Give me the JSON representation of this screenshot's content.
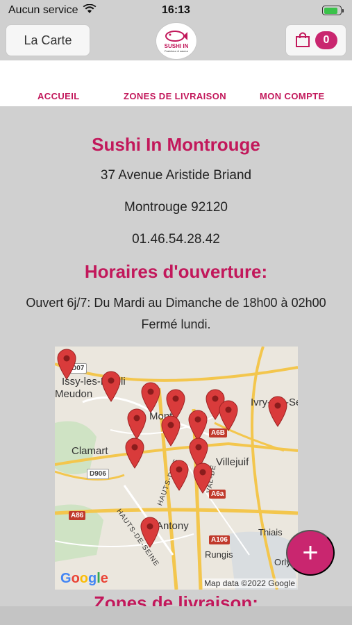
{
  "status_bar": {
    "carrier": "Aucun service",
    "time": "16:13",
    "battery_level": 0.85
  },
  "header": {
    "menu_label": "La Carte",
    "logo_title": "SUSHI IN",
    "logo_subtitle": "Fraîcheur & saveur",
    "cart_count": "0"
  },
  "nav": {
    "items": [
      "ACCUEIL",
      "ZONES DE LIVRAISON",
      "MON COMPTE"
    ]
  },
  "restaurant": {
    "name": "Sushi In Montrouge",
    "address": "37 Avenue Aristide Briand",
    "city": "Montrouge 92120",
    "phone": "01.46.54.28.42"
  },
  "hours": {
    "title": "Horaires d'ouverture:",
    "line1": "Ouvert 6j/7: Du Mardi au Dimanche de 18h00 à 02h00",
    "line2": "Fermé lundi."
  },
  "map": {
    "labels": {
      "issy": "Issy-les-Mouli",
      "meudon": "Meudon",
      "montrouge": "Mont",
      "ivry": "Ivry-sur-Sei",
      "clamart": "Clamart",
      "villejuif": "Villejuif",
      "antony": "Antony",
      "thiais": "Thiais",
      "rungis": "Rungis",
      "orly": "Orly",
      "hauts_de_seine_1": "HAUTS-DE-S",
      "hauts_de_seine_2": "HAUTS-DE-SEINE",
      "val_de": "VAL-DE"
    },
    "road_signs": {
      "d07": "D07",
      "a6b": "A6B",
      "d906": "D906",
      "a6a": "A6a",
      "a86": "A86",
      "a106": "A106"
    },
    "google": "Google",
    "attribution": "Map data ©2022 Google"
  },
  "zones_title": "Zones de livraison:",
  "fab_symbol": "+",
  "colors": {
    "accent": "#c2185b",
    "fab": "#c9266f",
    "pin": "#d93b3b",
    "background": "#d0d0d0"
  }
}
